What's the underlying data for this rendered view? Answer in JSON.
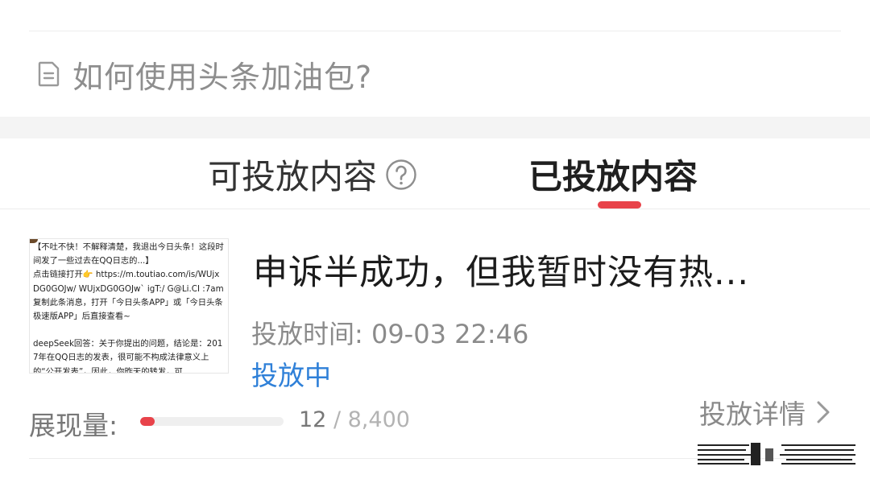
{
  "help": {
    "text": "如何使用头条加油包?"
  },
  "tabs": [
    {
      "label": "可投放内容",
      "active": false
    },
    {
      "label": "已投放内容",
      "active": true
    }
  ],
  "accent_color": "#e8434a",
  "link_color": "#2f80d8",
  "card": {
    "thumbnail_lines": [
      "【不吐不快！不解释清楚，我退出今日头条！这段时间发了一些过去在QQ日志的...】",
      "点击链接打开👉 https://m.toutiao.com/is/WUjxDG0GOJw/ WUjxDG0GOJw` igT:/ G@Li.CI :7am",
      "复制此条消息，打开「今日头条APP」或「今日头条极速版APP」后直接查看~",
      "",
      "deepSeek回答：关于你提出的问题，结论是：2017年在QQ日志的发表，很可能不构成法律意义上的“公开发表”，因此，你昨天的转发，可"
    ],
    "title": "申诉半成功，但我暂时没有热...",
    "time_label": "投放时间: 09-03 22:46",
    "status": "投放中",
    "impressions_label": "展现量:",
    "impressions_current": "12",
    "impressions_separator": " / ",
    "impressions_total": "8,400",
    "progress_fraction": 0.0014,
    "details_label": "投放详情"
  },
  "icons": {
    "help": "document-icon",
    "question": "question-circle-icon",
    "details": "chevron-right-icon"
  }
}
